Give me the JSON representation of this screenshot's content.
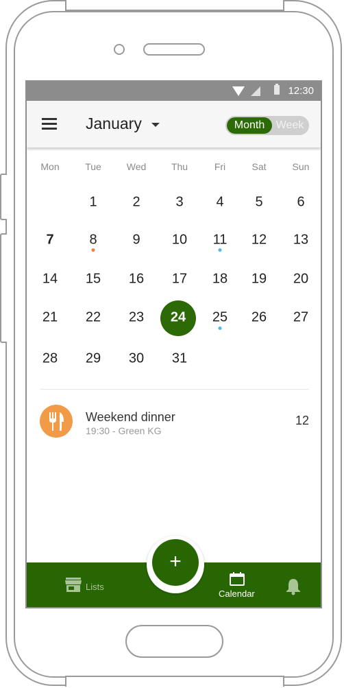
{
  "status_bar": {
    "time": "12:30"
  },
  "app_bar": {
    "month": "January",
    "toggle": {
      "month_label": "Month",
      "week_label": "Week",
      "selected": "Month"
    }
  },
  "weekdays": [
    "Mon",
    "Tue",
    "Wed",
    "Thu",
    "Fri",
    "Sat",
    "Sun"
  ],
  "calendar": {
    "today": "24",
    "days": [
      "1",
      "2",
      "3",
      "4",
      "5",
      "6",
      "7",
      "8",
      "9",
      "10",
      "11",
      "12",
      "13",
      "14",
      "15",
      "16",
      "17",
      "18",
      "19",
      "20",
      "21",
      "22",
      "23",
      "24",
      "25",
      "26",
      "27",
      "28",
      "29",
      "30",
      "31"
    ],
    "event_dots": {
      "8": "#f0823c",
      "11": "#4fb8e4",
      "25": "#4fb8e4"
    }
  },
  "event": {
    "title": "Weekend dinner",
    "subtitle": "19:30 - Green KG",
    "count": "12",
    "icon": "cutlery-icon",
    "color": "#f19a48"
  },
  "bottom_nav": {
    "lists_label": "Lists",
    "calendar_label": "Calendar",
    "fab_icon": "+"
  },
  "colors": {
    "brand": "#286604",
    "today_circle": "#2b6a05",
    "accent": "#f19a48"
  }
}
